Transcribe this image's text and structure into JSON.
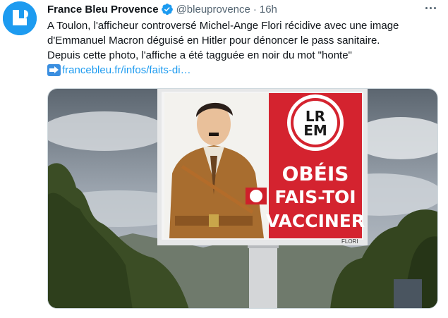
{
  "author": {
    "display_name": "France Bleu Provence",
    "handle": "@bleuprovence",
    "separator": "·",
    "timestamp": "16h",
    "avatar_icon": "france-bleu-logo-icon",
    "verified_icon": "verified-badge-icon"
  },
  "tweet": {
    "lines": [
      "A Toulon, l'afficheur controversé Michel-Ange Flori récidive avec une image",
      "d'Emmanuel Macron déguisé en Hitler pour dénoncer le pass sanitaire.",
      "Depuis cette photo, l'affiche a été tagguée en noir du mot \"honte\""
    ],
    "link_icon": "right-arrow-emoji-icon",
    "link_text": "francebleu.fr/infos/faits-di…"
  },
  "media": {
    "poster_logo_top": "LR",
    "poster_logo_bottom": "EM",
    "poster_line1": "OBÉIS",
    "poster_line2": "FAIS-TOI",
    "poster_line3": "VACCINER",
    "signature": "FLORI"
  },
  "colors": {
    "brand_blue": "#1d9bf0",
    "poster_red": "#d4232f",
    "text_primary": "#0f1419",
    "text_secondary": "#536471"
  }
}
